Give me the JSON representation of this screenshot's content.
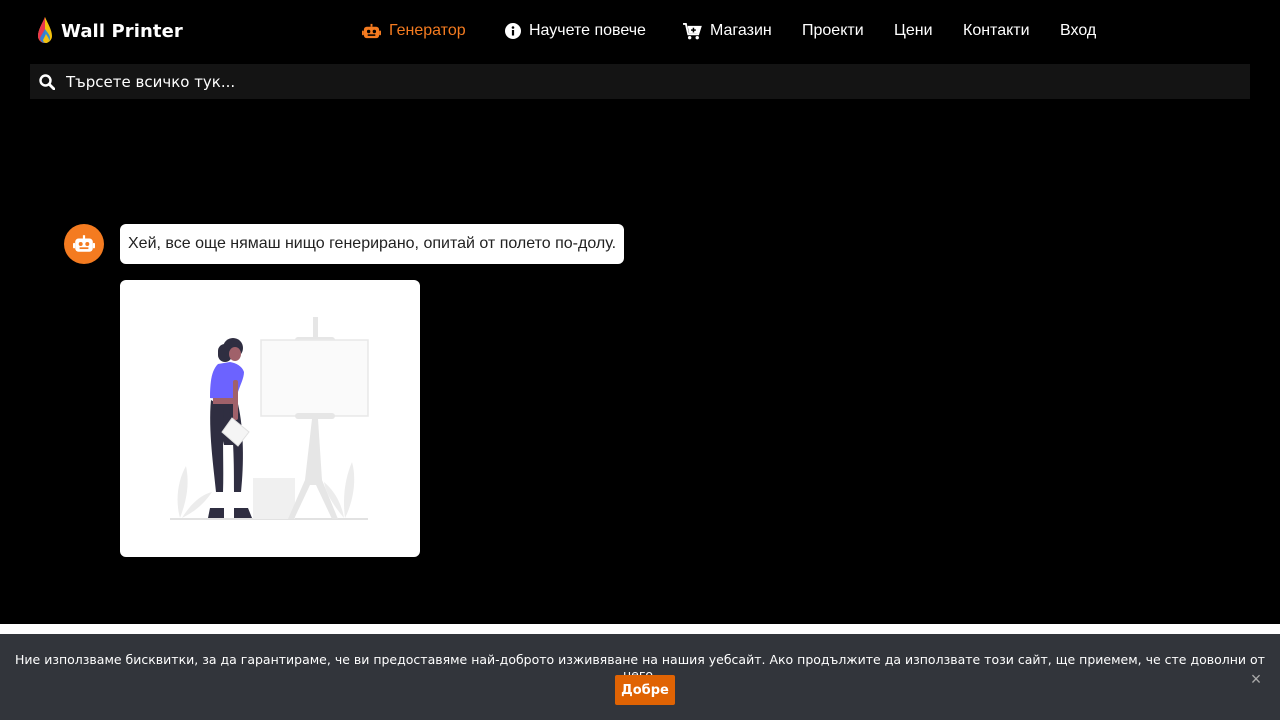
{
  "header": {
    "brand": "Wall Printer",
    "nav": [
      {
        "label": "Генератор",
        "icon": "robot-icon",
        "active": true
      },
      {
        "label": "Научете повече",
        "icon": "info-circle-icon",
        "active": false
      },
      {
        "label": "Магазин",
        "icon": "cart-icon",
        "active": false
      },
      {
        "label": "Проекти",
        "icon": null,
        "active": false
      },
      {
        "label": "Цени",
        "icon": null,
        "active": false
      },
      {
        "label": "Контакти",
        "icon": null,
        "active": false
      },
      {
        "label": "Вход",
        "icon": null,
        "active": false
      }
    ]
  },
  "search": {
    "placeholder": "Търсете всичко тук..."
  },
  "chat": {
    "message": "Хей, все още нямаш нищо генерирано, опитай от полето по-долу."
  },
  "cookie": {
    "text": "Ние използваме бисквитки, за да гарантираме, че ви предоставяме най-доброто изживяване на нашия уебсайт. Ако продължите да използвате този сайт, ще приемем, че сте доволни от него.",
    "accept_label": "Добре",
    "close_symbol": "×"
  },
  "colors": {
    "accent": "#f47b20",
    "background": "#000000",
    "cookie_bg": "#32353b",
    "cookie_button": "#e06303"
  }
}
